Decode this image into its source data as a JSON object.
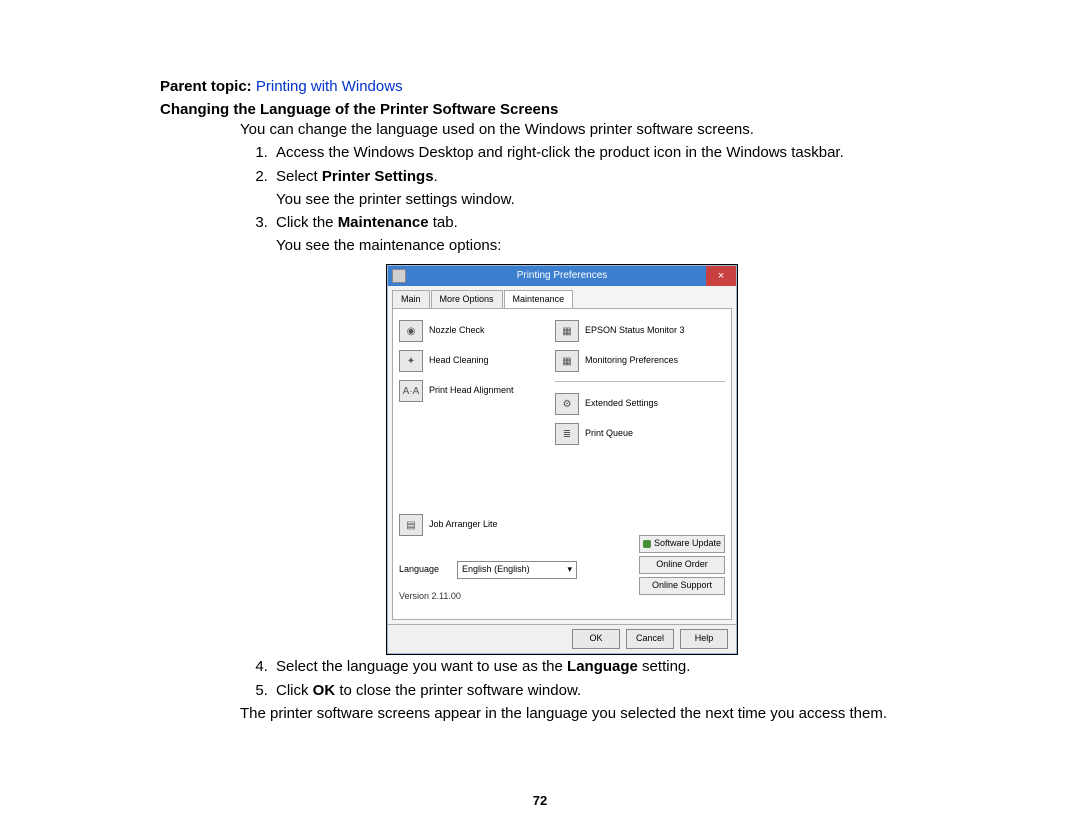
{
  "parent_topic": {
    "label": "Parent topic: ",
    "link": "Printing with Windows"
  },
  "section_title": "Changing the Language of the Printer Software Screens",
  "intro": "You can change the language used on the Windows printer software screens.",
  "steps": {
    "s1": "Access the Windows Desktop and right-click the product icon in the Windows taskbar.",
    "s2a": "Select ",
    "s2b": "Printer Settings",
    "s2c": ".",
    "s2_after": "You see the printer settings window.",
    "s3a": "Click the ",
    "s3b": "Maintenance",
    "s3c": " tab.",
    "s3_after": "You see the maintenance options:",
    "s4a": "Select the language you want to use as the ",
    "s4b": "Language",
    "s4c": " setting.",
    "s5a": "Click ",
    "s5b": "OK",
    "s5c": " to close the printer software window."
  },
  "concl": "The printer software screens appear in the language you selected the next time you access them.",
  "page_number": "72",
  "dialog": {
    "title": "Printing Preferences",
    "close": "×",
    "tabs": {
      "t1": "Main",
      "t2": "More Options",
      "t3": "Maintenance"
    },
    "left": {
      "i1": "Nozzle Check",
      "i2": "Head Cleaning",
      "i3": "Print Head Alignment"
    },
    "right": {
      "i1": "EPSON Status Monitor 3",
      "i2": "Monitoring Preferences",
      "i3": "Extended Settings",
      "i4": "Print Queue"
    },
    "job": "Job Arranger Lite",
    "lang_label": "Language",
    "lang_value": "English (English)",
    "rbtns": {
      "b1": "Software Update",
      "b2": "Online Order",
      "b3": "Online Support"
    },
    "version": "Version 2.11.00",
    "foot": {
      "ok": "OK",
      "cancel": "Cancel",
      "help": "Help"
    },
    "icons": {
      "nozzle": "◉",
      "clean": "✦",
      "align": "A·A",
      "status": "▦",
      "monitor": "▦",
      "ext": "⚙",
      "queue": "≣",
      "job": "▤",
      "chev": "▾"
    }
  }
}
